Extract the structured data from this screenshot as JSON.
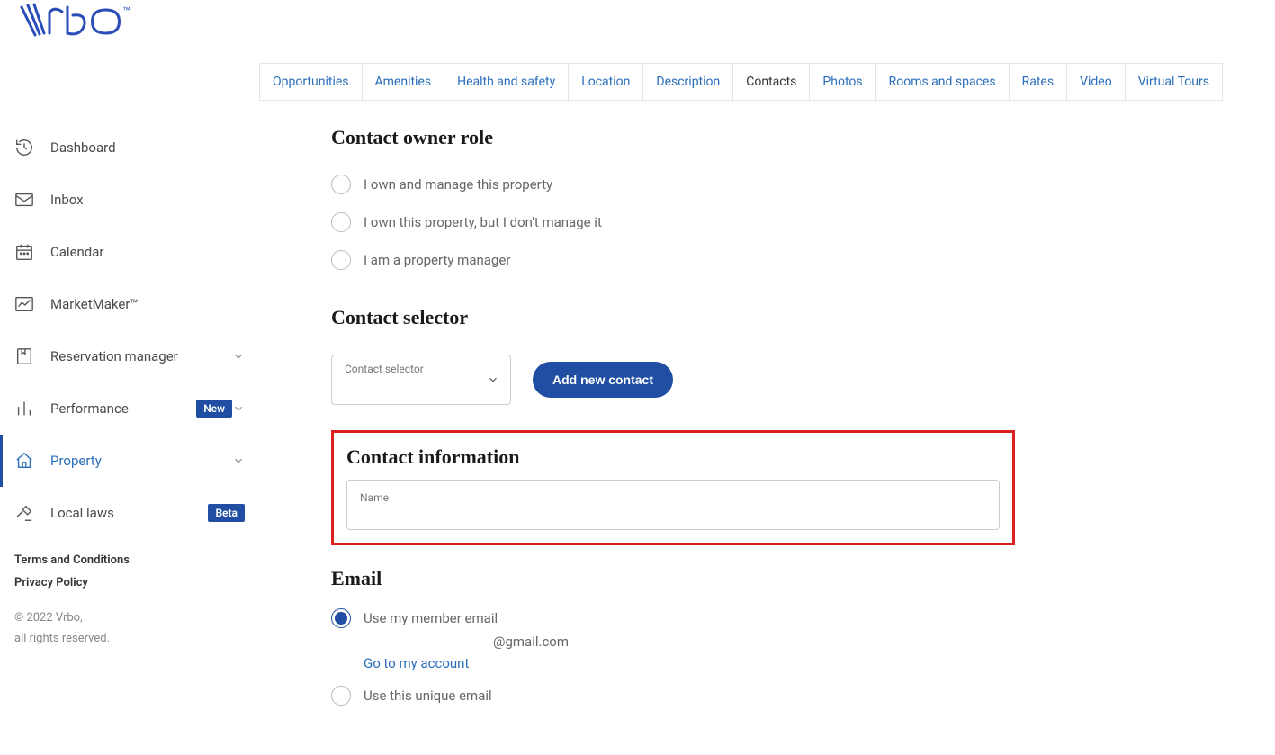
{
  "brand": "Vrbo",
  "sidebar": {
    "items": [
      {
        "label": "Dashboard"
      },
      {
        "label": "Inbox"
      },
      {
        "label": "Calendar"
      },
      {
        "label": "MarketMaker™"
      },
      {
        "label": "Reservation manager"
      },
      {
        "label": "Performance",
        "badge": "New"
      },
      {
        "label": "Property"
      },
      {
        "label": "Local laws",
        "badge": "Beta"
      }
    ],
    "footer": {
      "terms": "Terms and Conditions",
      "privacy": "Privacy Policy",
      "copy1": "© 2022 Vrbo,",
      "copy2": "all rights reserved."
    }
  },
  "tabs": [
    "Opportunities",
    "Amenities",
    "Health and safety",
    "Location",
    "Description",
    "Contacts",
    "Photos",
    "Rooms and spaces",
    "Rates",
    "Video",
    "Virtual Tours"
  ],
  "tabs_active_index": 5,
  "sections": {
    "owner_role": {
      "title": "Contact owner role",
      "options": [
        "I own and manage this property",
        "I own this property, but I don't manage it",
        "I am a property manager"
      ]
    },
    "selector": {
      "title": "Contact selector",
      "float_label": "Contact selector",
      "button": "Add new contact"
    },
    "contact_info": {
      "title": "Contact information",
      "name_label": "Name"
    },
    "email": {
      "title": "Email",
      "opt_member": "Use my member email",
      "member_value": "@gmail.com",
      "account_link": "Go to my account",
      "opt_unique": "Use this unique email"
    }
  }
}
